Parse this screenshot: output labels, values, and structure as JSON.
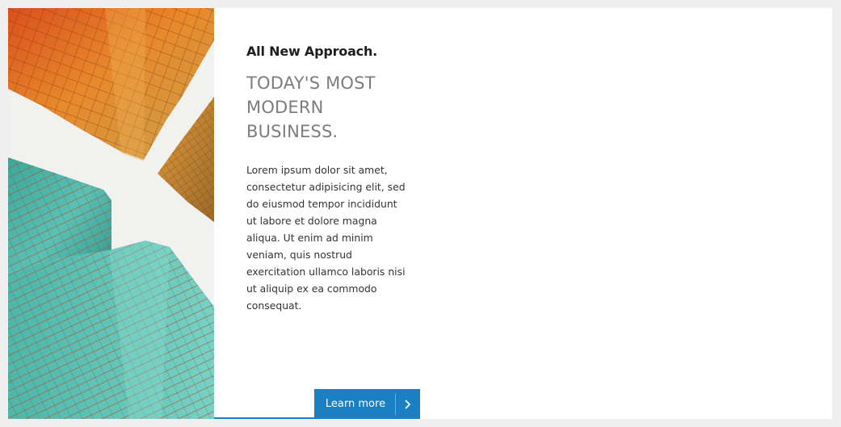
{
  "promo": {
    "kicker": "All New Approach.",
    "headline_lines": [
      "TODAY'S MOST",
      "MODERN",
      "BUSINESS."
    ],
    "body": "Lorem ipsum dolor sit amet, consectetur adipisicing elit, sed do eiusmod tempor incididunt ut labore et dolore magna aliqua. Ut enim ad minim veniam, quis nostrud exercitation ullamco laboris nisi ut aliquip ex ea commodo consequat.",
    "cta_label": "Learn more",
    "cta_icon": "chevron-right-icon"
  },
  "colors": {
    "accent": "#1b80c3",
    "page_bg": "#efefef",
    "headline": "#7d7d7d"
  },
  "image": {
    "subject": "skyscrapers-looking-up"
  }
}
